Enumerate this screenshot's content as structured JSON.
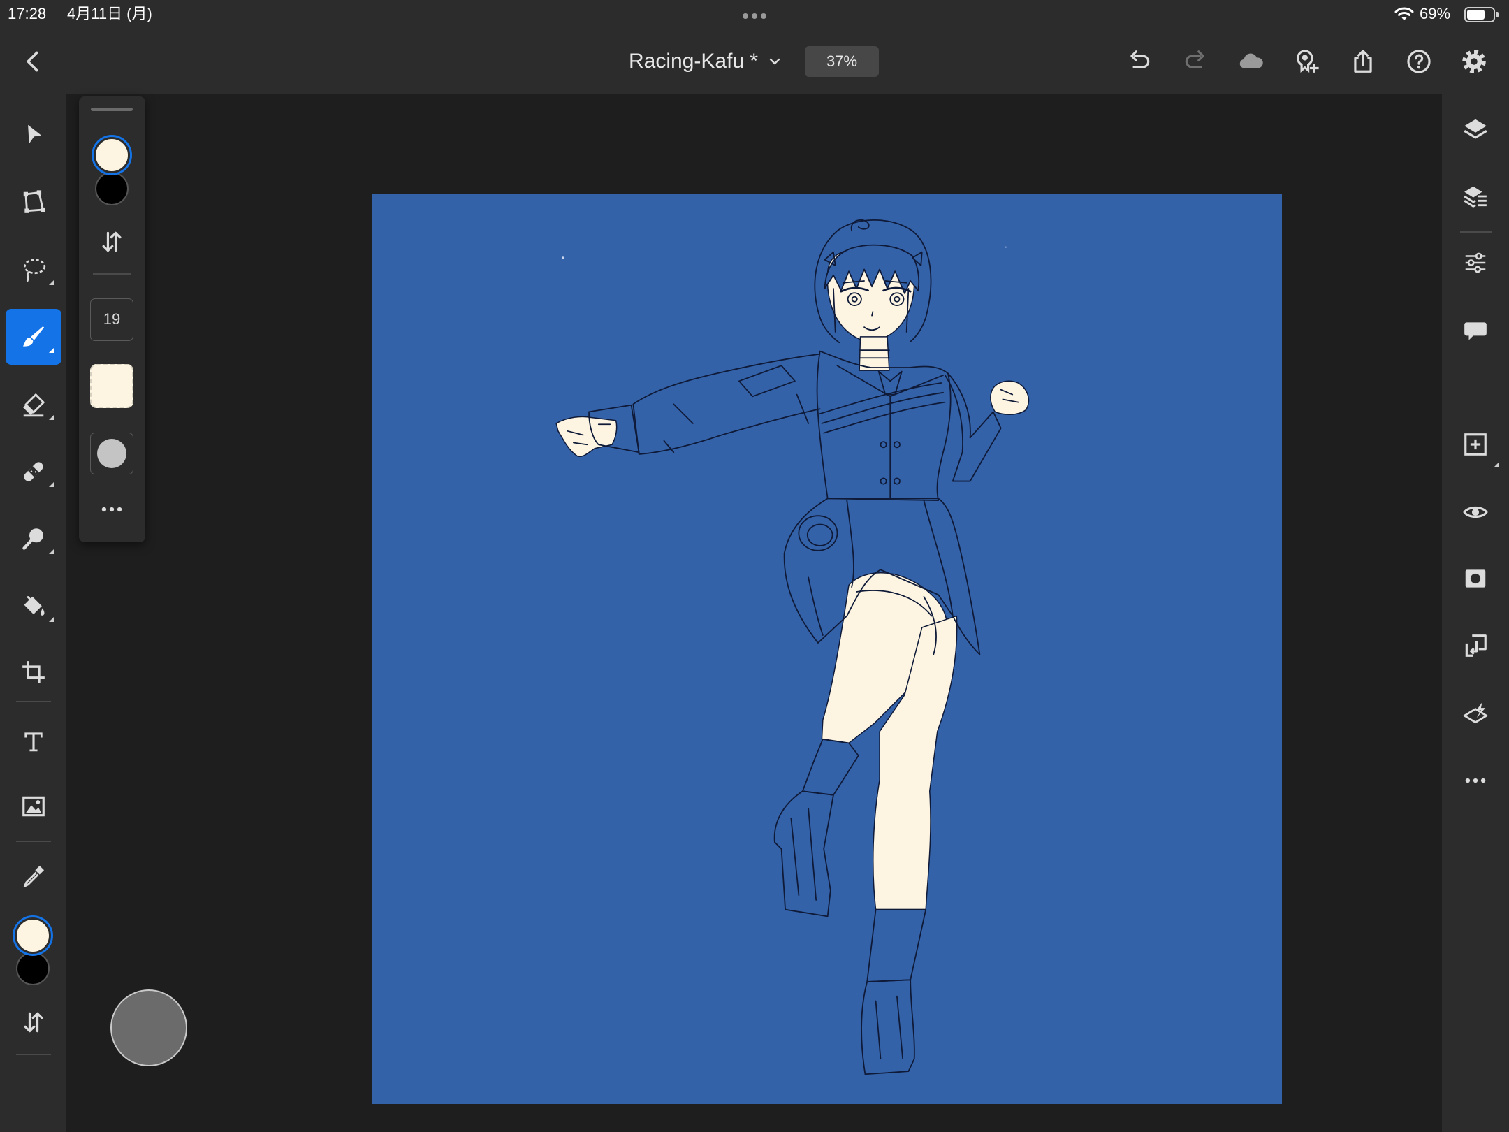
{
  "status_bar": {
    "time": "17:28",
    "date": "4月11日 (月)",
    "battery_percent": "69%",
    "battery_level": 0.69,
    "icons": [
      "multitasking-dots-icon",
      "wifi-icon",
      "battery-icon"
    ]
  },
  "top_bar": {
    "document_title": "Racing-Kafu *",
    "zoom": "37%",
    "icons": [
      "back-icon",
      "title-chevron-down-icon",
      "undo-icon",
      "redo-icon",
      "cloud-icon",
      "invite-user-icon",
      "share-icon",
      "help-icon",
      "settings-gear-icon"
    ]
  },
  "left_toolbar": {
    "tools": [
      "select-arrow-icon",
      "transform-icon",
      "lasso-icon",
      "brush-icon",
      "eraser-icon",
      "healing-icon",
      "smudge-icon",
      "fill-bucket-icon",
      "crop-icon",
      "text-tool-icon",
      "place-image-icon",
      "eyedropper-icon",
      "swap-colors-icon"
    ],
    "active_tool_icon": "brush-icon"
  },
  "tool_options": {
    "brush_size": "19",
    "icons": [
      "swap-colors-icon",
      "more-options-icon"
    ]
  },
  "right_toolbar": {
    "icons": [
      "layers-icon",
      "layer-properties-icon",
      "adjustments-icon",
      "comments-icon",
      "add-layer-icon",
      "visibility-eye-icon",
      "mask-icon",
      "import-icon",
      "layer-effects-icon",
      "more-icon"
    ]
  },
  "colors": {
    "accent": "#1473e6",
    "foreground_color": "#fdf5e2",
    "background_color": "#000000",
    "canvas": "#3462a8",
    "chrome": "#2c2c2c",
    "workspace": "#1e1e1e"
  }
}
